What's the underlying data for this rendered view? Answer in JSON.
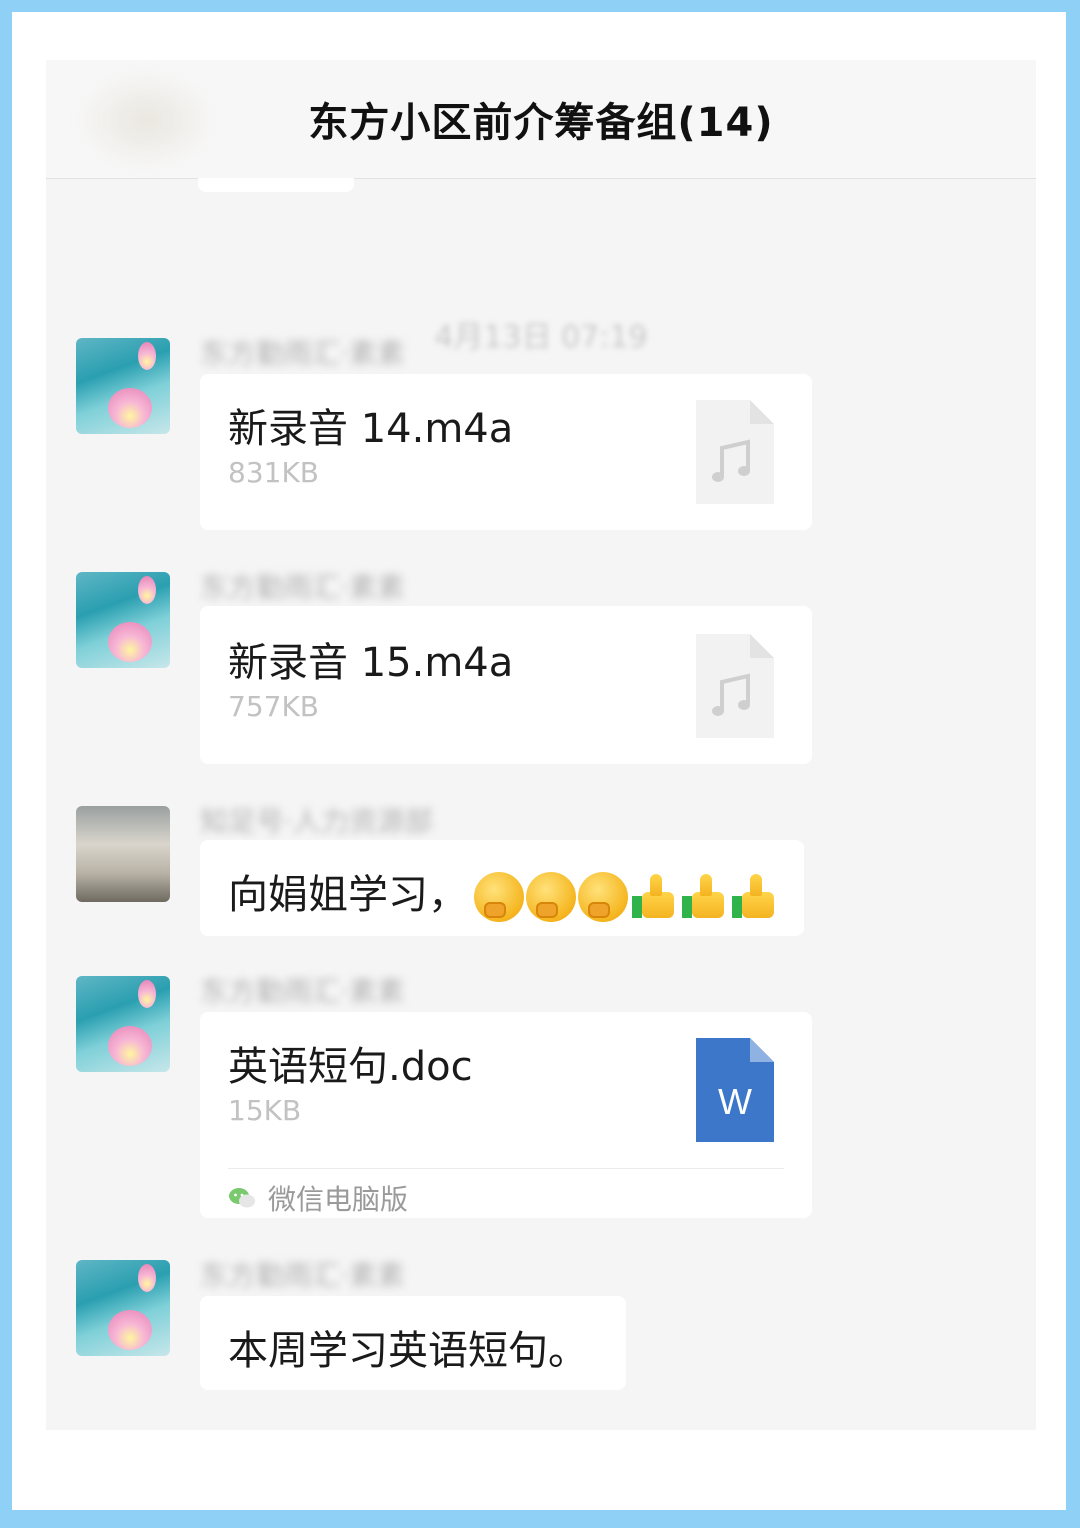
{
  "header": {
    "title": "东方小区前介筹备组(14)"
  },
  "timestamp": "4月13日 07:19",
  "messages": [
    {
      "sender": "东方勤雨汇·素素",
      "type": "file",
      "file_name": "新录音 14.m4a",
      "file_size": "831KB",
      "icon": "audio-file-icon"
    },
    {
      "sender": "东方勤雨汇·素素",
      "type": "file",
      "file_name": "新录音 15.m4a",
      "file_size": "757KB",
      "icon": "audio-file-icon"
    },
    {
      "sender": "知足号·人力资源部",
      "type": "text",
      "text": "向娟姐学习，",
      "emojis": [
        "hugging-face",
        "hugging-face",
        "hugging-face",
        "thumbs-up",
        "thumbs-up",
        "thumbs-up"
      ]
    },
    {
      "sender": "东方勤雨汇·素素",
      "type": "file",
      "file_name": "英语短句.doc",
      "file_size": "15KB",
      "icon": "word-file-icon",
      "icon_letter": "W",
      "source": "微信电脑版"
    },
    {
      "sender": "东方勤雨汇·素素",
      "type": "text",
      "text": "本周学习英语短句。"
    }
  ],
  "colors": {
    "frame": "#8fd0f7",
    "chat_bg": "#f5f5f5",
    "bubble": "#ffffff",
    "word_blue": "#3d77c9"
  }
}
